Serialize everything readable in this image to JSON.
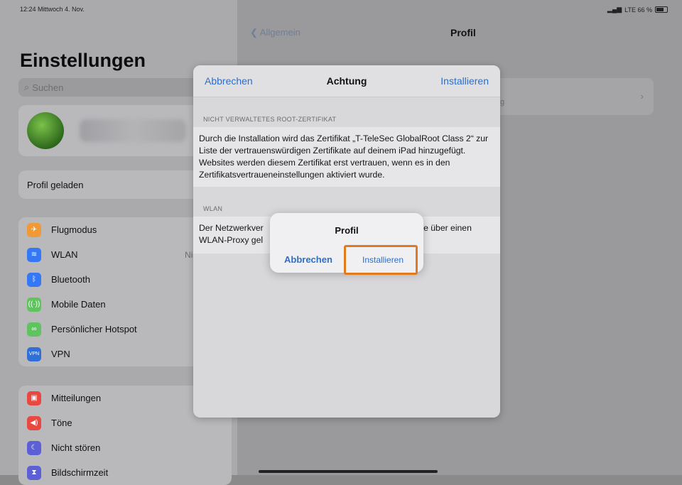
{
  "status_bar": {
    "time_date": "12:24  Mittwoch 4. Nov.",
    "network": "LTE 66 %"
  },
  "sidebar": {
    "title": "Einstellungen",
    "search_placeholder": "Suchen",
    "profile_loaded": "Profil geladen",
    "group1": [
      {
        "label": "Flugmodus",
        "icon": "airplane-icon",
        "color": "#f09a37",
        "value": ""
      },
      {
        "label": "WLAN",
        "icon": "wifi-icon",
        "color": "#3478f6",
        "value": "Nicht verb"
      },
      {
        "label": "Bluetooth",
        "icon": "bluetooth-icon",
        "color": "#3478f6",
        "value": ""
      },
      {
        "label": "Mobile Daten",
        "icon": "antenna-icon",
        "color": "#5fc45f",
        "value": ""
      },
      {
        "label": "Persönlicher Hotspot",
        "icon": "hotspot-icon",
        "color": "#5fc45f",
        "value": ""
      },
      {
        "label": "VPN",
        "icon": "vpn-icon",
        "color": "#2f6fd6",
        "value": ""
      }
    ],
    "group2": [
      {
        "label": "Mitteilungen",
        "icon": "notifications-icon",
        "color": "#e8483f"
      },
      {
        "label": "Töne",
        "icon": "sound-icon",
        "color": "#e8483f"
      },
      {
        "label": "Nicht stören",
        "icon": "moon-icon",
        "color": "#5c5fd6"
      },
      {
        "label": "Bildschirmzeit",
        "icon": "hourglass-icon",
        "color": "#5c5fd6"
      }
    ]
  },
  "detail": {
    "back_label": "Allgemein",
    "title": "Profil",
    "fragment": "g"
  },
  "sheet": {
    "cancel": "Abbrechen",
    "title": "Achtung",
    "install": "Installieren",
    "section1_header": "NICHT VERWALTETES ROOT-ZERTIFIKAT",
    "section1_body": "Durch die Installation wird das Zertifikat „T-TeleSec GlobalRoot Class 2“ zur Liste der vertrauenswürdigen Zertifikate auf deinem iPad hinzugefügt. Websites werden diesem Zertifikat erst vertrauen, wenn es in den Zertifikatsvertraueneinstellungen aktiviert wurde.",
    "section2_header": "WLAN",
    "section2_body_left": "Der Netzwerkver",
    "section2_body_left2": "WLAN-Proxy gel",
    "section2_body_right": "se über einen"
  },
  "alert": {
    "title": "Profil",
    "cancel": "Abbrechen",
    "install": "Installieren"
  },
  "colors": {
    "accent": "#2e6fc7",
    "highlight": "#e07a1f"
  }
}
